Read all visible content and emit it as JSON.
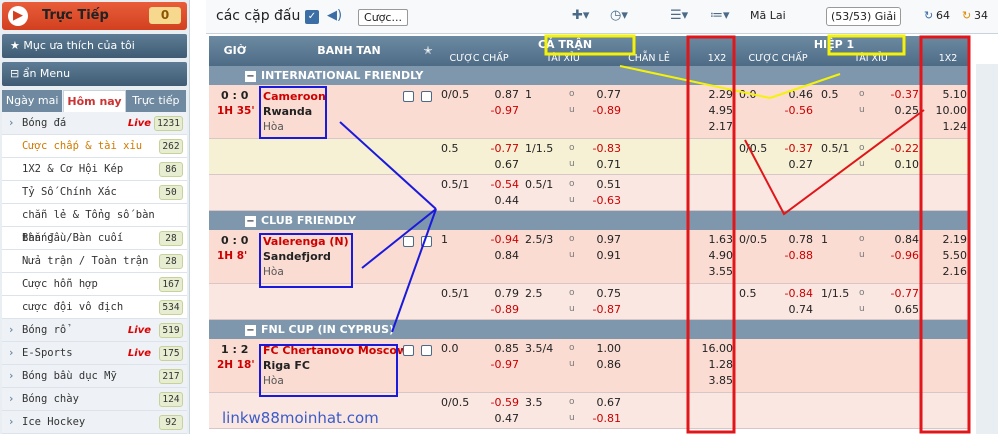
{
  "sidebar": {
    "live_label": "Trực Tiếp",
    "live_count": "0",
    "fav_label": "Mục ưa thích của tôi",
    "menu_toggle": "ẩn Menu",
    "tabs": [
      "Ngày mai",
      "Hôm nay",
      "Trực tiếp"
    ],
    "items": [
      {
        "label": "Bóng đá",
        "live": "Live",
        "count": "1231",
        "kind": "sport"
      },
      {
        "label": "Cược chấp & tài xỉu",
        "count": "262",
        "kind": "sub-sel"
      },
      {
        "label": "1X2 & Cơ Hội Kép",
        "count": "86",
        "kind": "sub"
      },
      {
        "label": "Tỷ Số Chính Xác",
        "count": "50",
        "kind": "sub"
      },
      {
        "label": "chẵn lẻ & Tổng số bàn thắng",
        "count": "",
        "kind": "sub"
      },
      {
        "label": "Bàn đầu/Bàn cuối",
        "count": "28",
        "kind": "sub"
      },
      {
        "label": "Nửa trận / Toàn trận",
        "count": "28",
        "kind": "sub"
      },
      {
        "label": "Cược hỗn hợp",
        "count": "167",
        "kind": "sub"
      },
      {
        "label": "cược đội vô địch",
        "count": "534",
        "kind": "sub"
      },
      {
        "label": "Bóng rổ",
        "live": "Live",
        "count": "519",
        "kind": "sport"
      },
      {
        "label": "E-Sports",
        "live": "Live",
        "count": "175",
        "kind": "sport"
      },
      {
        "label": "Bóng bầu dục Mỹ",
        "count": "217",
        "kind": "sport"
      },
      {
        "label": "Bóng chày",
        "count": "124",
        "kind": "sport"
      },
      {
        "label": "Ice Hockey",
        "count": "92",
        "kind": "sport"
      }
    ]
  },
  "top": {
    "title": "các cặp đấu",
    "bet_btn": "Cược...",
    "odds_type": "Mã Lai",
    "count": "(53/53) Giải",
    "c1": "64",
    "c2": "34"
  },
  "header": {
    "time": "GIỜ",
    "match": "BANH TAN",
    "full": "CẢ TRẬN",
    "half": "HIỆP 1",
    "hdp": "CƯỢC CHẤP",
    "ou": "TÀI XỈU",
    "oe": "CHẴN LẺ",
    "x12": "1X2",
    "hdp2": "CƯỢC CHẤP",
    "ou2": "TÀI XỈU",
    "x122": "1X2"
  },
  "leagues": [
    {
      "name": "INTERNATIONAL FRIENDLY",
      "matches": [
        {
          "score": "0 : 0",
          "time": "1H 35'",
          "home": "Cameroon",
          "away": "Rwanda",
          "draw": "Hòa",
          "rows": [
            {
              "hdp": "0/0.5",
              "h1": "0.87",
              "h2": "-0.97",
              "ou": "1",
              "o1": "0.77",
              "o2": "-0.89",
              "x": [
                "2.29",
                "4.95",
                "2.17"
              ],
              "hh": "0.0",
              "hh1": "0.46",
              "hh2": "-0.56",
              "hou": "0.5",
              "ho1": "-0.37",
              "ho2": "0.25",
              "hx": [
                "5.10",
                "10.00",
                "1.24"
              ]
            },
            {
              "hdp": "0.5",
              "h1": "-0.77",
              "h2": "0.67",
              "ou": "1/1.5",
              "o1": "-0.83",
              "o2": "0.71",
              "hh": "0/0.5",
              "hh1": "-0.37",
              "hh2": "0.27",
              "hou": "0.5/1",
              "ho1": "-0.22",
              "ho2": "0.10"
            },
            {
              "hdp": "0.5/1",
              "h1": "-0.54",
              "h2": "0.44",
              "ou": "0.5/1",
              "o1": "0.51",
              "o2": "-0.63"
            }
          ]
        }
      ]
    },
    {
      "name": "CLUB FRIENDLY",
      "matches": [
        {
          "score": "0 : 0",
          "time": "1H 8'",
          "home": "Valerenga (N)",
          "away": "Sandefjord",
          "draw": "Hòa",
          "rows": [
            {
              "hdp": "1",
              "h1": "-0.94",
              "h2": "0.84",
              "ou": "2.5/3",
              "o1": "0.97",
              "o2": "0.91",
              "x": [
                "1.63",
                "4.90",
                "3.55"
              ],
              "hh": "0/0.5",
              "hh1": "0.78",
              "hh2": "-0.88",
              "hou": "1",
              "ho1": "0.84",
              "ho2": "-0.96",
              "hx": [
                "2.19",
                "5.50",
                "2.16"
              ]
            },
            {
              "hdp": "0.5/1",
              "h1": "0.79",
              "h2": "-0.89",
              "ou": "2.5",
              "o1": "0.75",
              "o2": "-0.87",
              "hh": "0.5",
              "hh1": "-0.84",
              "hh2": "0.74",
              "hou": "1/1.5",
              "ho1": "-0.77",
              "ho2": "0.65"
            }
          ]
        }
      ]
    },
    {
      "name": "FNL CUP (IN CYPRUS)",
      "matches": [
        {
          "score": "1 : 2",
          "time": "2H 18'",
          "home": "FC Chertanovo Moscow",
          "away": "Riga FC",
          "draw": "Hòa",
          "rows": [
            {
              "hdp": "0.0",
              "h1": "0.85",
              "h2": "-0.97",
              "ou": "3.5/4",
              "o1": "1.00",
              "o2": "0.86",
              "x": [
                "16.00",
                "1.28",
                "3.85"
              ]
            },
            {
              "hdp": "0/0.5",
              "h1": "-0.59",
              "h2": "0.47",
              "ou": "3.5",
              "o1": "0.67",
              "o2": "-0.81"
            }
          ]
        }
      ]
    }
  ],
  "watermark": "linkw88moinhat.com",
  "ou_over": "o",
  "ou_under": "u",
  "colors": {
    "accent_red": "#e0161a",
    "annot_blue": "#1a1adc",
    "annot_yellow": "#f4f20a"
  }
}
